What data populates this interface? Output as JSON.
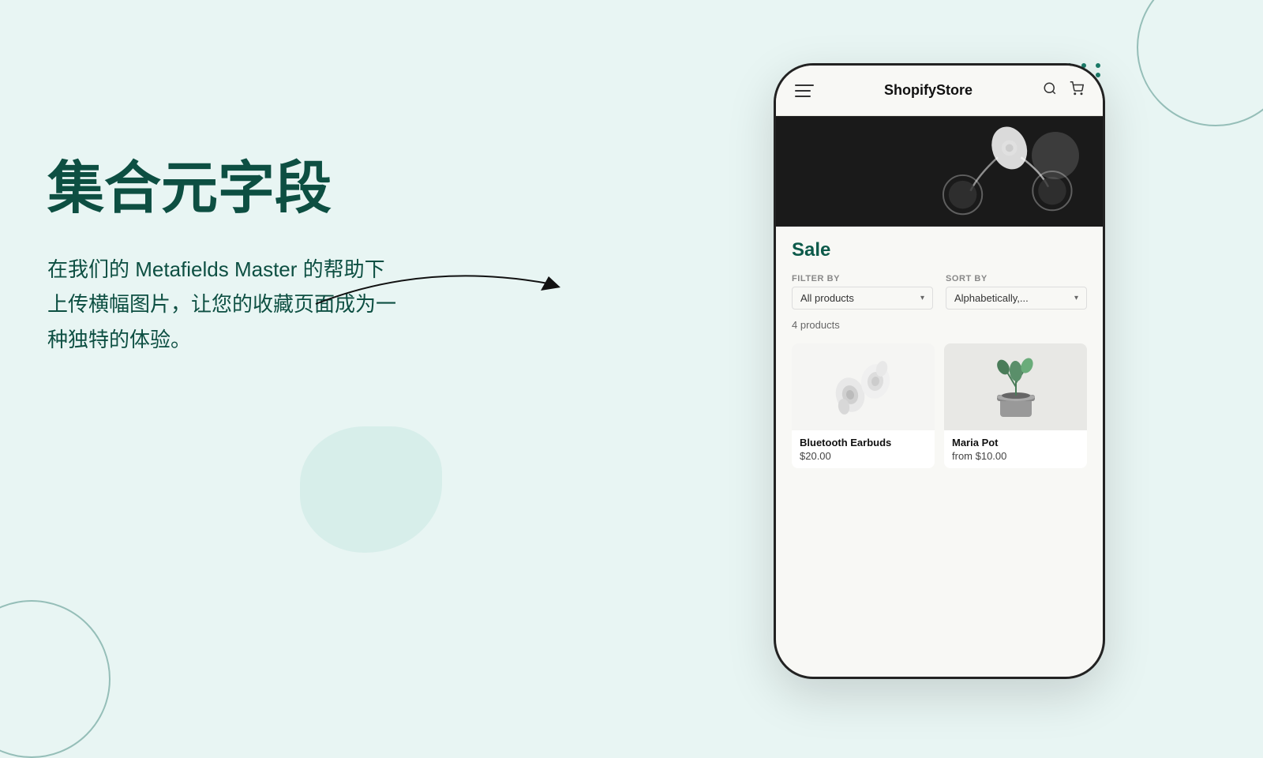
{
  "background": {
    "color": "#e8f5f3"
  },
  "left": {
    "title": "集合元字段",
    "subtitle": "在我们的 Metafields Master 的帮助下\n上传横幅图片，让您的收藏页面成为一\n种独特的体验。"
  },
  "phone": {
    "header": {
      "store_name": "ShopifyStore",
      "hamburger_label": "menu",
      "search_label": "search",
      "cart_label": "cart"
    },
    "collection": {
      "title": "Sale",
      "filter_label": "FILTER BY",
      "filter_value": "All products",
      "sort_label": "SORT BY",
      "sort_value": "Alphabetically,...",
      "products_count": "4 products",
      "products": [
        {
          "name": "Bluetooth Earbuds",
          "price": "$20.00",
          "type": "earbuds"
        },
        {
          "name": "Maria Pot",
          "price": "from $10.00",
          "type": "plant"
        }
      ]
    }
  },
  "dots": {
    "rows": 3,
    "cols": 5
  }
}
